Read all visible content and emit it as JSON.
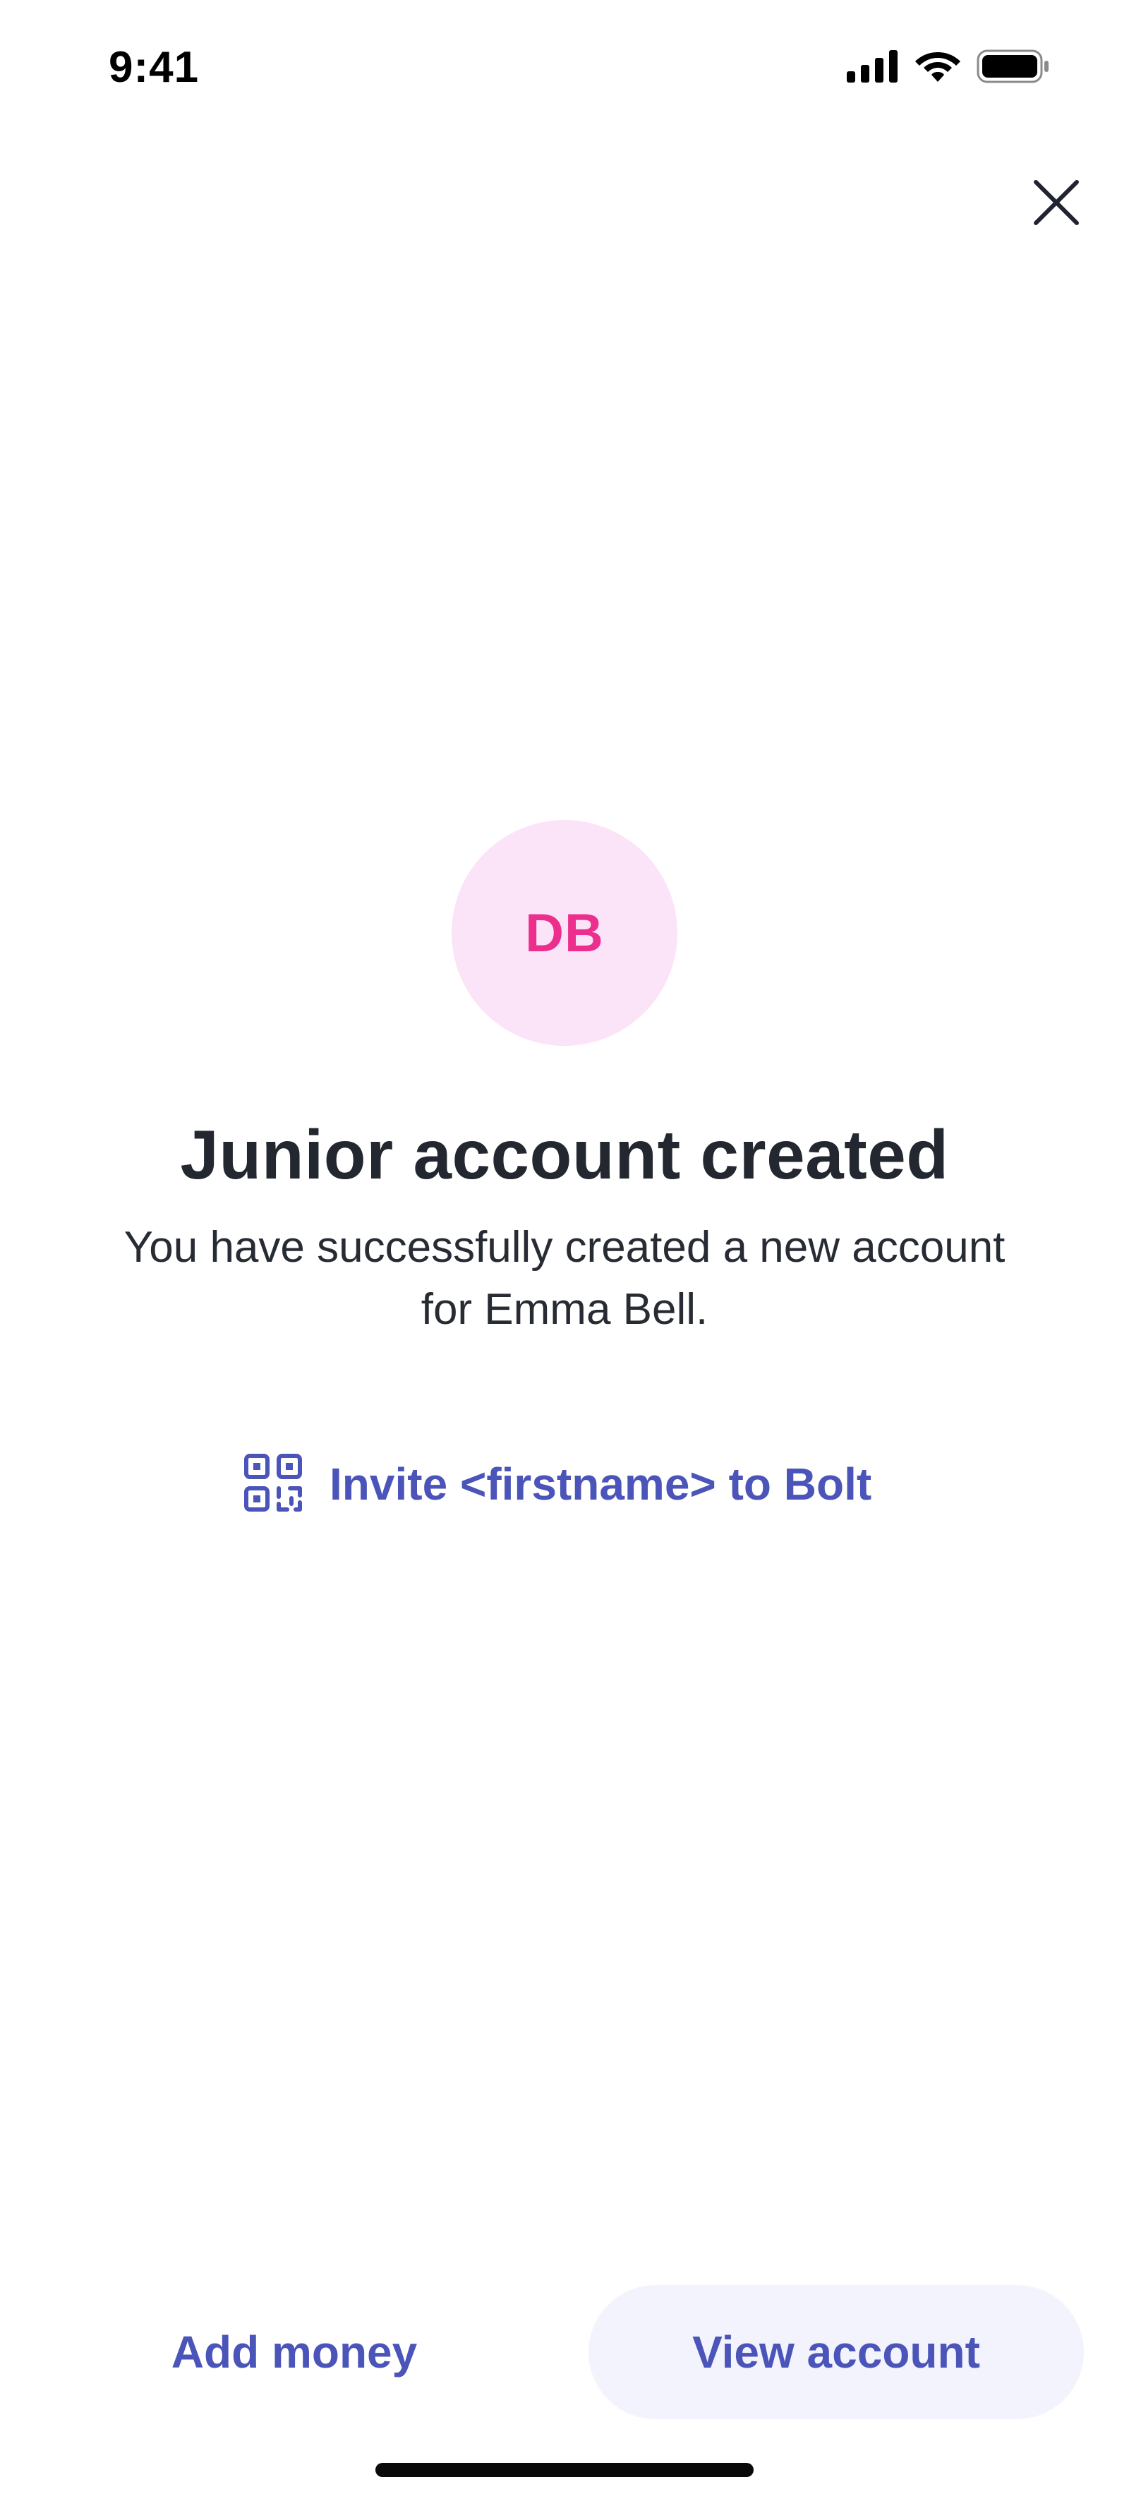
{
  "status_bar": {
    "time": "9:41",
    "icons": [
      "cellular-signal-icon",
      "wifi-icon",
      "battery-icon"
    ]
  },
  "close": {
    "icon": "close-icon"
  },
  "avatar": {
    "initials": "DB",
    "background_color": "#fbe4f8",
    "text_color": "#ec2f8c"
  },
  "title": "Junior account created",
  "subtitle": {
    "line1": "You have successfully created a new account",
    "line2": "for Emma Bell."
  },
  "invite": {
    "icon": "qr-code-icon",
    "label": "Invite <firstname> to Bolt"
  },
  "actions": {
    "add_money_label": "Add money",
    "view_account_label": "View account"
  },
  "colors": {
    "accent": "#4b54b8",
    "title": "#23272f",
    "button_bg": "#f3f3fd"
  }
}
